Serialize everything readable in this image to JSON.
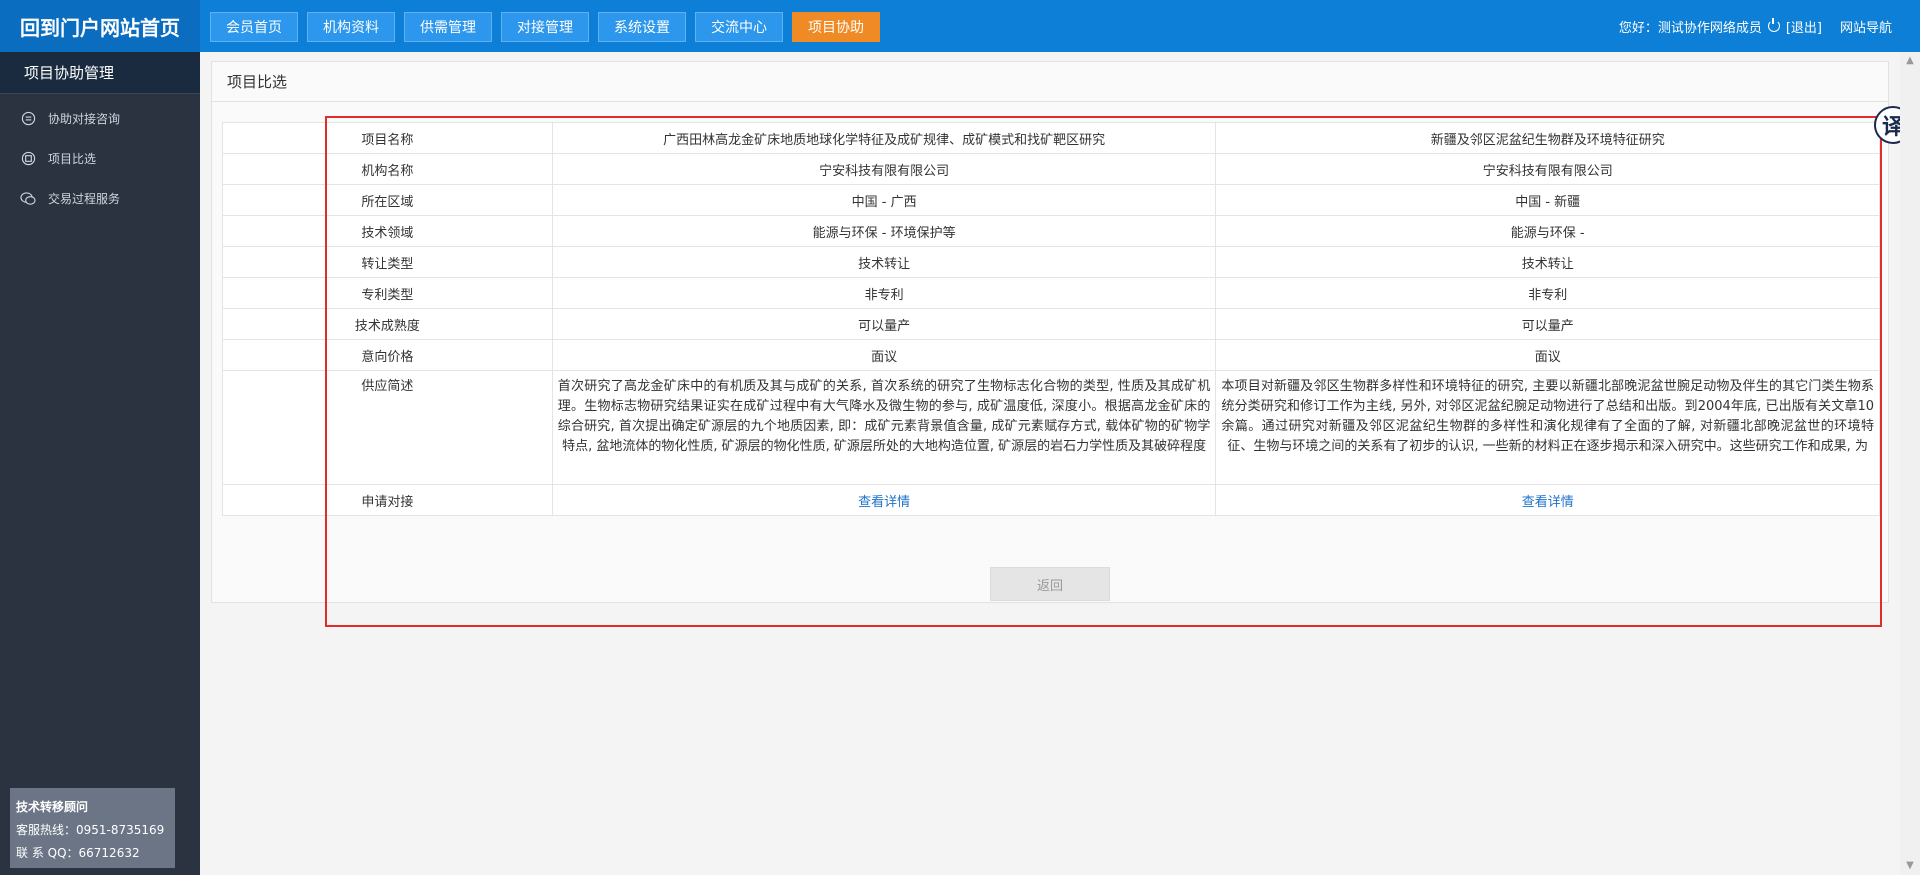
{
  "brand": "回到门户网站首页",
  "nav": [
    {
      "label": "会员首页",
      "active": false
    },
    {
      "label": "机构资料",
      "active": false
    },
    {
      "label": "供需管理",
      "active": false
    },
    {
      "label": "对接管理",
      "active": false
    },
    {
      "label": "系统设置",
      "active": false
    },
    {
      "label": "交流中心",
      "active": false
    },
    {
      "label": "项目协助",
      "active": true
    }
  ],
  "user": {
    "greeting": "您好：测试协作网络成员",
    "logout": "[退出]",
    "site_nav": "网站导航"
  },
  "sidebar": {
    "title": "项目协助管理",
    "items": [
      {
        "label": "协助对接咨询",
        "icon": "chat-icon"
      },
      {
        "label": "项目比选",
        "icon": "compare-icon"
      },
      {
        "label": "交易过程服务",
        "icon": "service-icon"
      }
    ]
  },
  "consult": {
    "title": "技术转移顾问",
    "hotline": "客服热线：0951-8735169",
    "qq": "联 系 QQ：66712632"
  },
  "panel": {
    "title": "项目比选",
    "back_label": "返回"
  },
  "compare": {
    "rows": [
      {
        "label": "项目名称",
        "a": "广西田林高龙金矿床地质地球化学特征及成矿规律、成矿模式和找矿靶区研究",
        "b": "新疆及邻区泥盆纪生物群及环境特征研究"
      },
      {
        "label": "机构名称",
        "a": "宁安科技有限有限公司",
        "b": "宁安科技有限有限公司"
      },
      {
        "label": "所在区域",
        "a": "中国 - 广西",
        "b": "中国 - 新疆"
      },
      {
        "label": "技术领域",
        "a": "能源与环保 - 环境保护等",
        "b": "能源与环保 -"
      },
      {
        "label": "转让类型",
        "a": "技术转让",
        "b": "技术转让"
      },
      {
        "label": "专利类型",
        "a": "非专利",
        "b": "非专利"
      },
      {
        "label": "技术成熟度",
        "a": "可以量产",
        "b": "可以量产"
      },
      {
        "label": "意向价格",
        "a": "面议",
        "b": "面议"
      }
    ],
    "desc": {
      "label": "供应简述",
      "a": "首次研究了高龙金矿床中的有机质及其与成矿的关系, 首次系统的研究了生物标志化合物的类型, 性质及其成矿机理。生物标志物研究结果证实在成矿过程中有大气降水及微生物的参与, 成矿温度低, 深度小。根据高龙金矿床的综合研究, 首次提出确定矿源层的九个地质因素, 即：成矿元素背景值含量, 成矿元素赋存方式, 载体矿物的矿物学特点, 盆地流体的物化性质, 矿源层的物化性质, 矿源层所处的大地构造位置, 矿源层的岩石力学性质及其破碎程度",
      "b": "本项目对新疆及邻区生物群多样性和环境特征的研究, 主要以新疆北部晚泥盆世腕足动物及伴生的其它门类生物系统分类研究和修订工作为主线, 另外, 对邻区泥盆纪腕足动物进行了总结和出版。到2004年底, 已出版有关文章10余篇。通过研究对新疆及邻区泥盆纪生物群的多样性和演化规律有了全面的了解, 对新疆北部晚泥盆世的环境特征、生物与环境之间的关系有了初步的认识, 一些新的材料正在逐步揭示和深入研究中。这些研究工作和成果, 为"
    },
    "apply": {
      "label": "申请对接",
      "a": "查看详情",
      "b": "查看详情"
    }
  },
  "translate_badge": "译",
  "colors": {
    "topbar": "#0e7fd6",
    "active_nav": "#f08a24",
    "sidebar": "#2b3340",
    "annotation": "#e22b2b",
    "link": "#1e73c9"
  }
}
